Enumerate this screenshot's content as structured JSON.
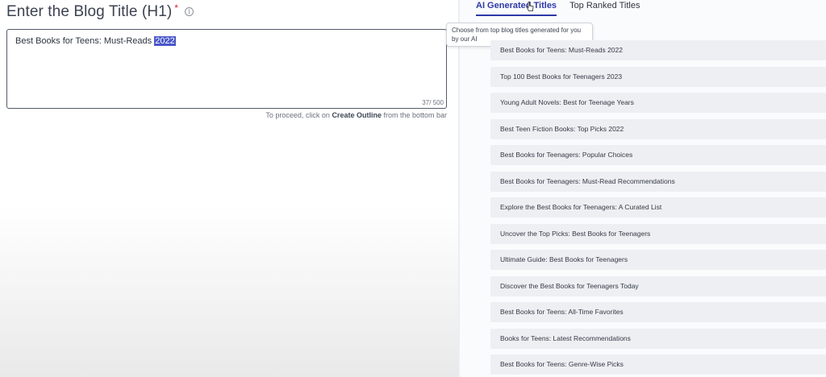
{
  "editor": {
    "heading": "Enter the Blog Title (H1)",
    "required_mark": "*",
    "title_value_prefix": "Best Books for Teens: Must-Reads ",
    "title_value_selected": "2022",
    "char_count": "37/ 500",
    "hint_prefix": "To proceed, click on ",
    "hint_link": "Create Outline",
    "hint_suffix": " from the bottom bar"
  },
  "tabs": [
    {
      "label": "AI Generated Titles",
      "active": true
    },
    {
      "label": "Top Ranked Titles",
      "active": false
    }
  ],
  "tooltip": "Choose from top blog titles generated for you by our AI",
  "titles": [
    "Best Books for Teens: Must-Reads 2022",
    "Top 100 Best Books for Teenagers 2023",
    "Young Adult Novels: Best for Teenage Years",
    "Best Teen Fiction Books: Top Picks 2022",
    "Best Books for Teenagers: Popular Choices",
    "Best Books for Teenagers: Must-Read Recommendations",
    "Explore the Best Books for Teenagers: A Curated List",
    "Uncover the Top Picks: Best Books for Teenagers",
    "Ultimate Guide: Best Books for Teenagers",
    "Discover the Best Books for Teenagers Today",
    "Best Books for Teens: All-Time Favorites",
    "Books for Teens: Latest Recommendations",
    "Best Books for Teens: Genre-Wise Picks"
  ],
  "colors": {
    "accent": "#2d39a8",
    "selection": "#4a57c8",
    "required": "#e0202e"
  }
}
